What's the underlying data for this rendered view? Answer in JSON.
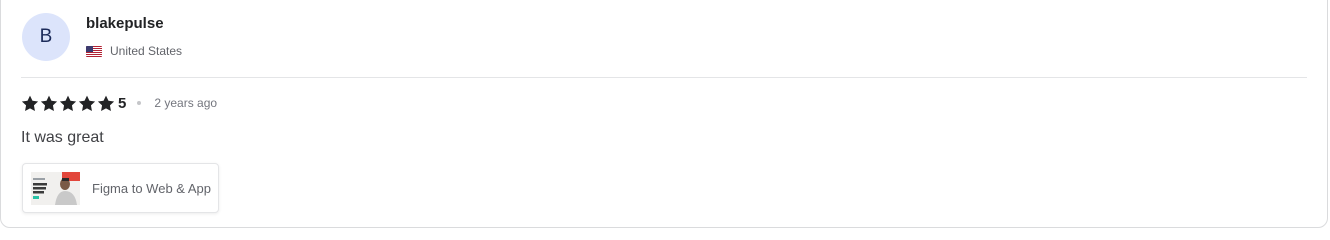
{
  "review": {
    "avatar_initial": "B",
    "username": "blakepulse",
    "country": "United States",
    "rating_value": "5",
    "star_count": 5,
    "time_ago": "2 years ago",
    "text": "It was great",
    "gig_title": "Figma to Web & App"
  },
  "colors": {
    "avatar_bg": "#dce4fb",
    "star": "#222325"
  },
  "icons": {
    "flag": "us-flag-icon",
    "star": "star-icon"
  }
}
